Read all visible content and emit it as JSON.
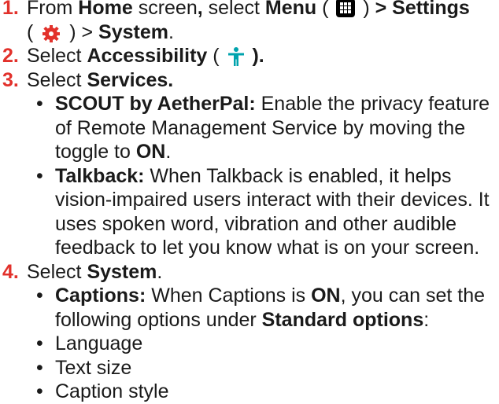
{
  "steps": [
    {
      "num": "1.",
      "t1": "From ",
      "b1": "Home",
      "t2": " screen",
      "b2": ",",
      "t3": " select ",
      "b3": "Menu",
      "t4": " ( ",
      "t5": " ) ",
      "b4": "> Settings",
      "t6": "( ",
      "t7": " ) > ",
      "b5": "System",
      "t8": "."
    },
    {
      "num": "2.",
      "t1": "Select ",
      "b1": "Accessibility",
      "t2": " ( ",
      "b2": " )."
    },
    {
      "num": "3.",
      "t1": "Select ",
      "b1": "Services."
    },
    {
      "num": "4.",
      "t1": "Select ",
      "b1": "System",
      "t2": "."
    }
  ],
  "services": [
    {
      "title": "SCOUT  by AetherPal:",
      "text": " Enable the privacy feature of Remote Management Service by moving the toggle to ",
      "bold_end": "ON",
      "end": "."
    },
    {
      "title": "Talkback:",
      "text": " When Talkback is enabled,  it helps vision-impaired users interact with their devices. It uses spoken word, vibration and other audible feedback to let you know what is on your screen."
    }
  ],
  "system": {
    "title": "Captions:",
    "t1": " When Captions is ",
    "b1": "ON",
    "t2": ", you can set the following options under ",
    "b2": "Standard options",
    "t3": ":",
    "options": [
      "Language",
      "Text size",
      "Caption style"
    ]
  },
  "bullet": "•",
  "icons": {
    "menu": "menu-grid-icon",
    "settings": "settings-gear-icon",
    "accessibility": "accessibility-icon"
  },
  "colors": {
    "step_number": "#e2312b",
    "gear": "#e2312b",
    "accessibility": "#00a3ad",
    "text": "#1a1a1a"
  }
}
